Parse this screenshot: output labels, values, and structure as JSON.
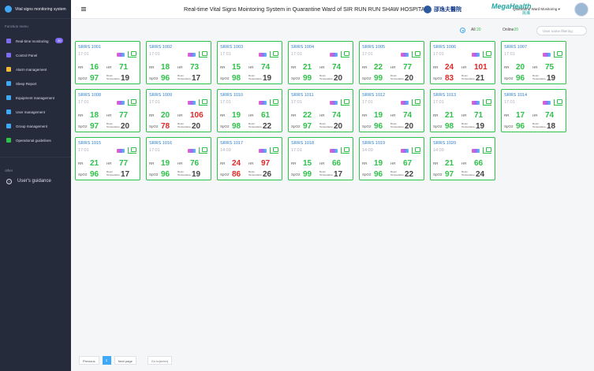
{
  "app": {
    "logo_text": "Vital signs monitoring system",
    "title": "Real-time Vital Signs Mointoring System in Quarantine Ward of SIR RUN RUN SHAW HOSPITAL",
    "hospital_text": "邵逸夫醫院",
    "brand": "MegaHealth",
    "brand_sub": "挑瀬",
    "ward_select": "Quarantine Ward Monitoring ▾"
  },
  "sidebar": {
    "section_title": "Function menu",
    "items": [
      {
        "label": "Real-time monitoring",
        "badge": "20",
        "color": "#7e6cf0"
      },
      {
        "label": "Control Panel",
        "color": "#7e6cf0"
      },
      {
        "label": "Alarm management",
        "color": "#f5b93a"
      },
      {
        "label": "Sleep Report",
        "color": "#3fa9f5"
      },
      {
        "label": "Equipment management",
        "color": "#3fa9f5"
      },
      {
        "label": "User management",
        "color": "#3fa9f5"
      },
      {
        "label": "Group management",
        "color": "#3fa9f5"
      },
      {
        "label": "Operational guidelines",
        "color": "#2fc24a"
      }
    ],
    "other_title": "other",
    "guide_label": "User's guidance"
  },
  "toolbar": {
    "all_label": "All",
    "all_count": "20",
    "online_label": "Online",
    "online_count": "20",
    "filter_placeholder": "User name filtering"
  },
  "labels": {
    "rr": "RR",
    "hr": "HR",
    "spo2": "SpO2",
    "temp": "Room Temperature"
  },
  "cards": [
    {
      "name": "SRRS 1001",
      "time": "17:01",
      "rr": "16",
      "hr": "71",
      "spo2": "97",
      "temp": "19",
      "alarm": []
    },
    {
      "name": "SRRS 1002",
      "time": "17:01",
      "rr": "18",
      "hr": "73",
      "spo2": "96",
      "temp": "17",
      "alarm": []
    },
    {
      "name": "SRRS 1003",
      "time": "17:01",
      "rr": "15",
      "hr": "74",
      "spo2": "98",
      "temp": "19",
      "alarm": []
    },
    {
      "name": "SRRS 1004",
      "time": "17:01",
      "rr": "21",
      "hr": "74",
      "spo2": "99",
      "temp": "20",
      "alarm": []
    },
    {
      "name": "SRRS 1005",
      "time": "17:01",
      "rr": "22",
      "hr": "77",
      "spo2": "99",
      "temp": "20",
      "alarm": []
    },
    {
      "name": "SRRS 1006",
      "time": "17:01",
      "rr": "24",
      "hr": "101",
      "spo2": "83",
      "temp": "21",
      "alarm": [
        "rr",
        "hr",
        "spo2"
      ]
    },
    {
      "name": "SRRS 1007",
      "time": "17:01",
      "rr": "20",
      "hr": "75",
      "spo2": "96",
      "temp": "19",
      "alarm": []
    },
    {
      "name": "SRRS 1008",
      "time": "17:01",
      "rr": "18",
      "hr": "77",
      "spo2": "97",
      "temp": "20",
      "alarm": []
    },
    {
      "name": "SRRS 1009",
      "time": "17:01",
      "rr": "20",
      "hr": "106",
      "spo2": "78",
      "temp": "20",
      "alarm": [
        "hr",
        "spo2"
      ]
    },
    {
      "name": "SRRS  1010",
      "time": "17:01",
      "rr": "19",
      "hr": "61",
      "spo2": "98",
      "temp": "22",
      "alarm": []
    },
    {
      "name": "SRRS  1011",
      "time": "17:01",
      "rr": "22",
      "hr": "74",
      "spo2": "97",
      "temp": "20",
      "alarm": []
    },
    {
      "name": "SRRS  1012",
      "time": "17:01",
      "rr": "19",
      "hr": "74",
      "spo2": "96",
      "temp": "20",
      "alarm": []
    },
    {
      "name": "SRRS  1013",
      "time": "17:01",
      "rr": "21",
      "hr": "71",
      "spo2": "98",
      "temp": "19",
      "alarm": []
    },
    {
      "name": "SRRS  1014",
      "time": "17:01",
      "rr": "17",
      "hr": "74",
      "spo2": "96",
      "temp": "18",
      "alarm": []
    },
    {
      "name": "SRRS  1015",
      "time": "17:01",
      "rr": "21",
      "hr": "77",
      "spo2": "96",
      "temp": "17",
      "alarm": []
    },
    {
      "name": "SRRS  1016",
      "time": "17:01",
      "rr": "19",
      "hr": "76",
      "spo2": "96",
      "temp": "19",
      "alarm": []
    },
    {
      "name": "SRRS  1017",
      "time": "14:09",
      "rr": "24",
      "hr": "97",
      "spo2": "86",
      "temp": "26",
      "alarm": [
        "rr",
        "hr",
        "spo2"
      ]
    },
    {
      "name": "SRRS  1018",
      "time": "17:01",
      "rr": "15",
      "hr": "66",
      "spo2": "99",
      "temp": "17",
      "alarm": []
    },
    {
      "name": "SRRS  1019",
      "time": "14:09",
      "rr": "19",
      "hr": "67",
      "spo2": "96",
      "temp": "22",
      "alarm": []
    },
    {
      "name": "SRRS  1020",
      "time": "14:09",
      "rr": "21",
      "hr": "66",
      "spo2": "97",
      "temp": "24",
      "alarm": []
    }
  ],
  "pager": {
    "prev": "Previous",
    "page": "1",
    "next": "Next page",
    "goto": "Go to(enter)"
  }
}
